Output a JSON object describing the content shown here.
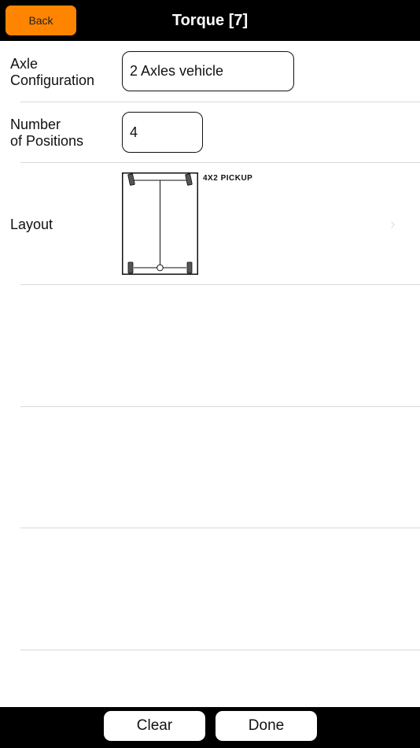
{
  "header": {
    "back_label": "Back",
    "title": "Torque [7]"
  },
  "form": {
    "axle": {
      "label_line1": "Axle",
      "label_line2": "Configuration",
      "value": "2 Axles vehicle"
    },
    "positions": {
      "label_line1": "Number",
      "label_line2": "of Positions",
      "value": "4"
    },
    "layout": {
      "label": "Layout",
      "caption": "4X2 PICKUP",
      "chevron_icon": "chevron-right-icon"
    }
  },
  "footer": {
    "clear_label": "Clear",
    "done_label": "Done"
  }
}
